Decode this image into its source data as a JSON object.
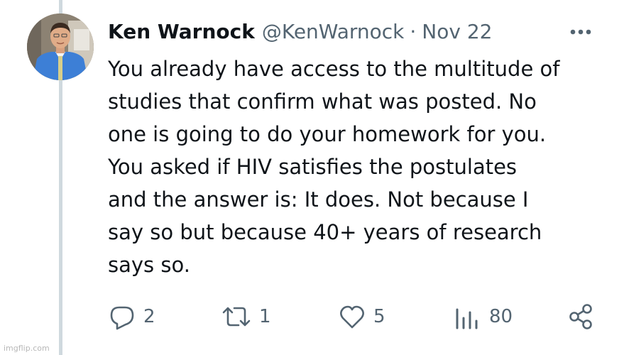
{
  "tweet": {
    "author_name": "Ken Warnock",
    "handle": "@KenWarnock",
    "separator": "·",
    "date": "Nov 22",
    "more_icon": "more-horizontal-icon",
    "body_lines": [
      "You already have access to the multitude of",
      "studies that confirm what was posted. No",
      "one is going to do your homework for you.",
      "You asked if HIV satisfies the postulates",
      "and the answer is: It does. Not because I",
      "say so but because 40+ years of research",
      "says so."
    ]
  },
  "actions": {
    "reply": {
      "icon": "reply-icon",
      "count": "2"
    },
    "retweet": {
      "icon": "retweet-icon",
      "count": "1"
    },
    "like": {
      "icon": "heart-icon",
      "count": "5"
    },
    "views": {
      "icon": "views-icon",
      "count": "80"
    },
    "share": {
      "icon": "share-icon"
    }
  },
  "watermark": "imgflip.com",
  "colors": {
    "text_primary": "#0f1419",
    "text_secondary": "#536471",
    "thread_line": "#cfd9de",
    "background": "#ffffff"
  }
}
